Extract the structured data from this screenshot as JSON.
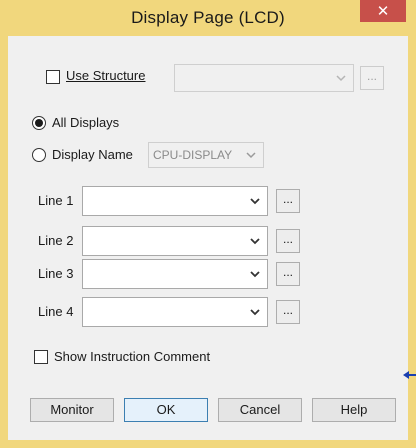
{
  "window": {
    "title": "Display Page (LCD)",
    "close_glyph": "✕"
  },
  "use_structure": {
    "label": "Use Structure",
    "checked": false,
    "combo_value": "",
    "ellipsis": "..."
  },
  "display_mode": {
    "all_displays_label": "All Displays",
    "display_name_label": "Display Name",
    "selected": "All Displays",
    "display_name_value": "CPU-DISPLAY"
  },
  "lines": [
    {
      "label": "Line 1",
      "value": "",
      "ellipsis": "..."
    },
    {
      "label": "Line 2",
      "value": "",
      "ellipsis": "..."
    },
    {
      "label": "Line 3",
      "value": "",
      "ellipsis": "..."
    },
    {
      "label": "Line 4",
      "value": "",
      "ellipsis": "..."
    }
  ],
  "show_comment": {
    "label": "Show Instruction Comment",
    "checked": false
  },
  "buttons": {
    "monitor": "Monitor",
    "ok": "OK",
    "cancel": "Cancel",
    "help": "Help"
  },
  "colors": {
    "title_bar": "#f1d77d",
    "client_bg": "#f0f0f0",
    "close_button": "#c7504a",
    "default_button_border": "#3c7fb1",
    "marker": "#1a3fb0"
  }
}
